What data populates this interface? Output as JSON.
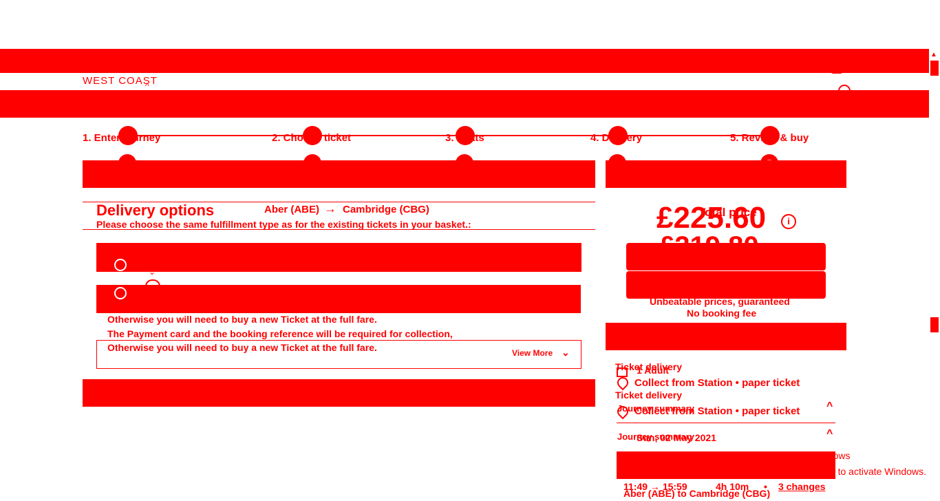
{
  "brand": {
    "name": "WEST COAST"
  },
  "stepper": {
    "steps": [
      {
        "label": "1. Enter journey"
      },
      {
        "label": "2. Choose ticket"
      },
      {
        "label": "3. Seats"
      },
      {
        "label": "4. Delivery"
      },
      {
        "label": "5. Review & buy"
      }
    ],
    "current_step_number": "5"
  },
  "delivery": {
    "title": "Delivery options",
    "route_from": "Aber (ABE)",
    "route_to": "Cambridge (CBG)",
    "instruction": "Please choose the same fulfillment type as for the existing tickets in your basket.:",
    "notice_line_1": "Otherwise you will need to buy a new Ticket at the full fare.",
    "notice_line_2": "The Payment card and the booking reference will be required for collection,",
    "notice_line_3": "Otherwise you will need to buy a new Ticket at the full fare.",
    "view_more": "View More"
  },
  "summary": {
    "total_label": "Total price",
    "total_price": "£225.60",
    "second_price": "£219.80",
    "promise_1": "Unbeatable prices, guaranteed",
    "promise_2": "No booking fee",
    "passengers": "1 Adult",
    "ticket_delivery_label": "Ticket delivery",
    "ticket_delivery_value": "Collect from Station • paper ticket",
    "journey_summary_label": "Journey summary",
    "journey_date": "Sun, 02 May 2021",
    "journey_times": "11:49 → 15:59",
    "journey_duration": "4h 10m",
    "journey_changes": "3 changes",
    "journey_route": "Aber (ABE) to Cambridge (CBG)"
  },
  "windows_watermark": {
    "line_1": "Activate Windows",
    "line_2": "Go to Settings to activate Windows."
  },
  "colors": {
    "accent": "#ff0000",
    "background": "#ffffff"
  }
}
